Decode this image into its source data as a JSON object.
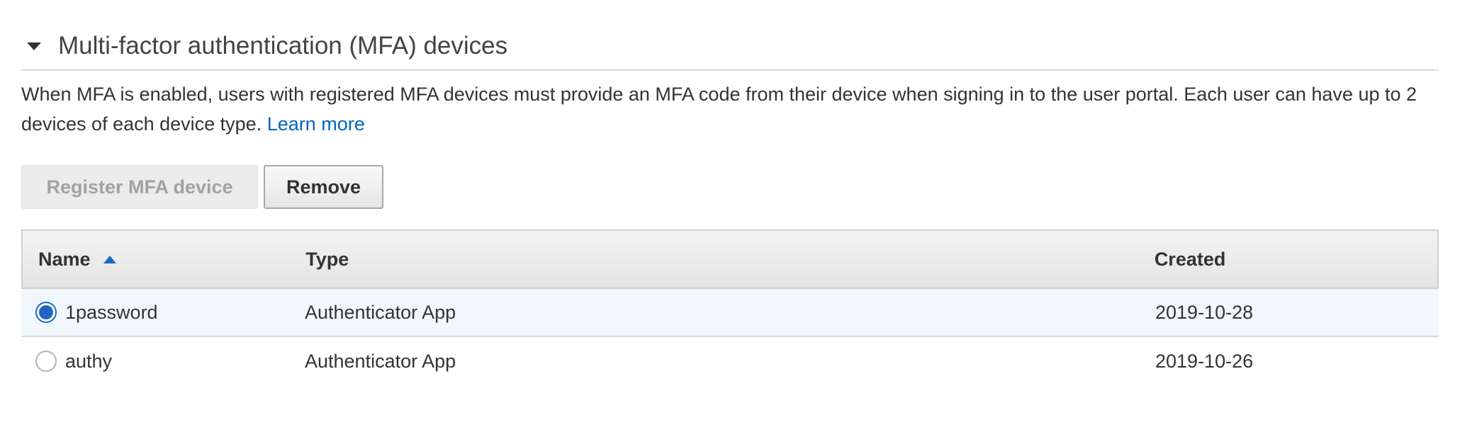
{
  "section": {
    "title": "Multi-factor authentication (MFA) devices",
    "description": "When MFA is enabled, users with registered MFA devices must provide an MFA code from their device when signing in to the user portal. Each user can have up to 2 devices of each device type.",
    "learn_more": "Learn more"
  },
  "buttons": {
    "register": "Register MFA device",
    "remove": "Remove"
  },
  "table": {
    "columns": {
      "name": "Name",
      "type": "Type",
      "created": "Created"
    },
    "sort": {
      "column": "Name",
      "direction": "ascending"
    },
    "rows": [
      {
        "name": "1password",
        "type": "Authenticator App",
        "created": "2019-10-28",
        "selected": true
      },
      {
        "name": "authy",
        "type": "Authenticator App",
        "created": "2019-10-26",
        "selected": false
      }
    ]
  },
  "colors": {
    "accent": "#1f66c0",
    "link": "#0066c0",
    "selected_row": "#f1f8fd"
  }
}
